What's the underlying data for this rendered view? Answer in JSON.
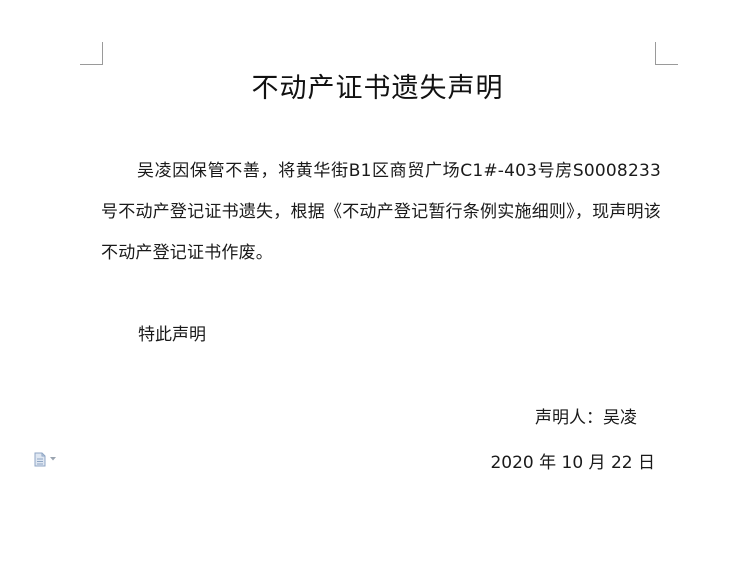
{
  "document": {
    "title": "不动产证书遗失声明",
    "paragraph": "吴凌因保管不善，将黄华街B1区商贸广场C1#-403号房S0008233号不动产登记证书遗失，根据《不动产登记暂行条例实施细则》，现声明该不动产登记证书作废。",
    "closing": "特此声明",
    "signer": "声明人：吴凌",
    "date": "2020 年 10 月 22 日"
  },
  "icons": {
    "paste_options": "document-icon",
    "dropdown": "caret-down-icon"
  },
  "colors": {
    "text": "#1a1a1a",
    "corner_marks": "#9a9a9a",
    "icon": "#8fa6c4"
  }
}
